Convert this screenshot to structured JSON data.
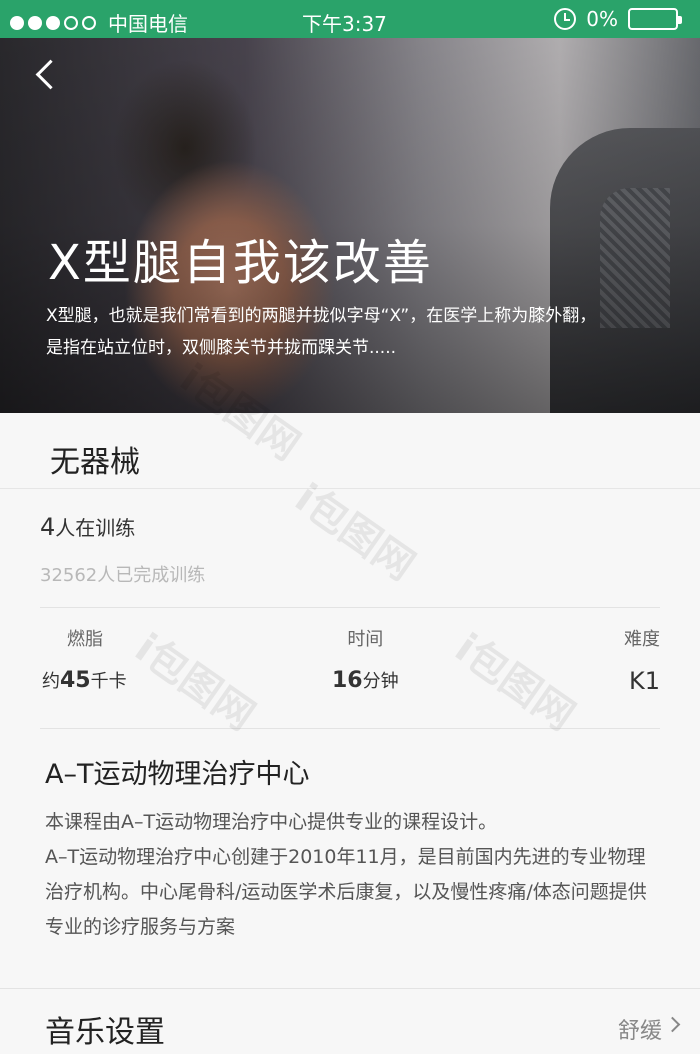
{
  "status_bar": {
    "carrier": "中国电信",
    "time": "下午3:37",
    "battery": "0%"
  },
  "hero": {
    "title": "X型腿自我该改善",
    "description": "X型腿，也就是我们常看到的两腿并拢似字母“X”，在医学上称为膝外翻，是指在站立位时，双侧膝关节并拢而踝关节....."
  },
  "equipment": "无器械",
  "training": {
    "count": "4",
    "count_suffix": "人在训练",
    "completed": "32562人已完成训练"
  },
  "stats": {
    "burn_label": "燃脂",
    "burn_prefix": "约",
    "burn_value": "45",
    "burn_unit": "千卡",
    "time_label": "时间",
    "time_value": "16",
    "time_unit": "分钟",
    "difficulty_label": "难度",
    "difficulty_value": "K1"
  },
  "center": {
    "name": "A–T运动物理治疗中心",
    "desc_line1": "本课程由A–T运动物理治疗中心提供专业的课程设计。",
    "desc_line2": "A–T运动物理治疗中心创建于2010年11月，是目前国内先进的专业物理治疗机构。中心尾骨科/运动医学术后康复，以及慢性疼痛/体态问题提供专业的诊疗服务与方案"
  },
  "music": {
    "label": "音乐设置",
    "value": "舒缓"
  },
  "watermark": "i包图网"
}
